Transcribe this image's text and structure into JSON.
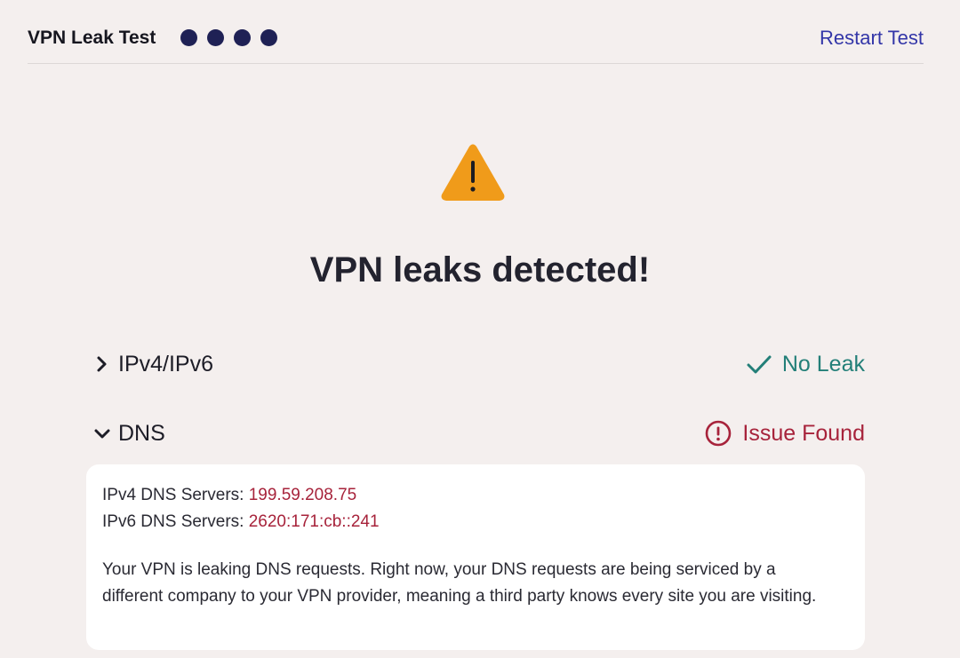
{
  "header": {
    "title": "VPN Leak Test",
    "progress_dots": 4,
    "restart_label": "Restart Test"
  },
  "result": {
    "icon": "warning-triangle-icon",
    "title": "VPN leaks detected!"
  },
  "tests": [
    {
      "label": "IPv4/IPv6",
      "expanded": false,
      "status": "No Leak",
      "status_icon": "checkmark-icon",
      "status_color": "#237f78"
    },
    {
      "label": "DNS",
      "expanded": true,
      "status": "Issue Found",
      "status_icon": "alert-circle-icon",
      "status_color": "#a7233b"
    }
  ],
  "dns_details": {
    "ipv4_label": "IPv4 DNS Servers:",
    "ipv4_value": "199.59.208.75",
    "ipv6_label": "IPv6 DNS Servers:",
    "ipv6_value": "2620:171:cb::241",
    "description": "Your VPN is leaking DNS requests. Right now, your DNS requests are being serviced by a different company to your VPN provider, meaning a third party knows every site you are visiting."
  },
  "colors": {
    "background": "#f4efee",
    "accent_link": "#3336a8",
    "dots": "#1f2155",
    "warning": "#f09b1a",
    "ok": "#237f78",
    "issue": "#a7233b"
  }
}
